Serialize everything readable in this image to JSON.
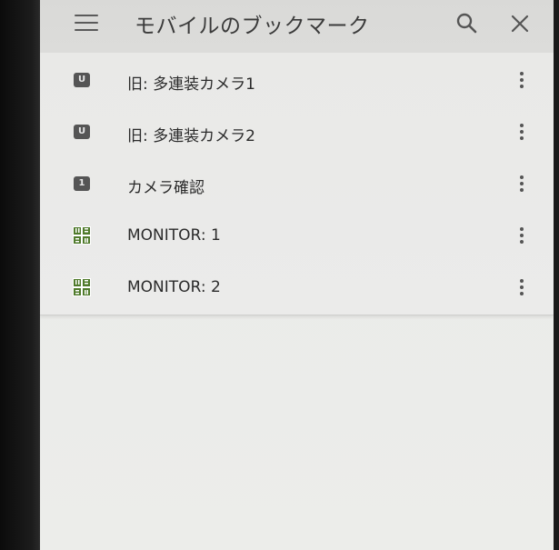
{
  "appbar": {
    "title": "モバイルのブックマーク",
    "menu_icon": "hamburger-menu-icon",
    "search_icon": "search-icon",
    "close_icon": "close-icon"
  },
  "bookmarks": [
    {
      "label": "旧: 多連装カメラ1",
      "icon": "u-badge",
      "badge_text": "U"
    },
    {
      "label": "旧: 多連装カメラ2",
      "icon": "u-badge",
      "badge_text": "U"
    },
    {
      "label": "カメラ確認",
      "icon": "number-badge",
      "badge_text": "1"
    },
    {
      "label": "MONITOR: 1",
      "icon": "ueda-logo"
    },
    {
      "label": "MONITOR: 2",
      "icon": "ueda-logo"
    }
  ],
  "colors": {
    "appbar_bg": "#dadad8",
    "list_bg": "#eaeae8",
    "text": "#2b2b2b",
    "logo_green": "#4f7a2b"
  }
}
